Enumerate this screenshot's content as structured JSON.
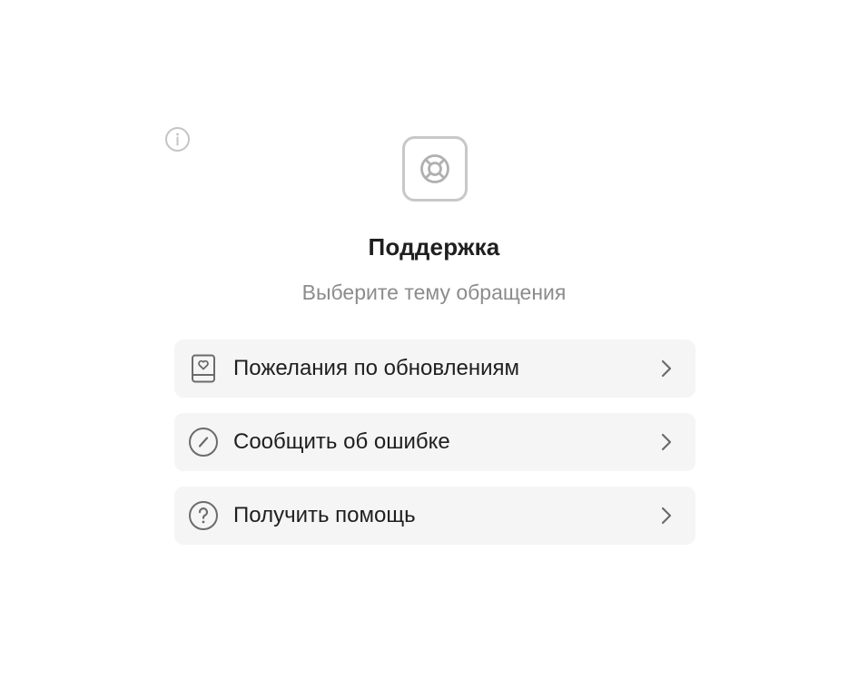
{
  "header": {
    "info_icon": "info-circle-icon",
    "hero_icon": "lifebuoy-icon",
    "title": "Поддержка",
    "subtitle": "Выберите тему обращения"
  },
  "menu": {
    "items": [
      {
        "label": "Пожелания по обновлениям",
        "icon": "book-heart-icon"
      },
      {
        "label": "Сообщить об ошибке",
        "icon": "slash-circle-icon"
      },
      {
        "label": "Получить помощь",
        "icon": "question-circle-icon"
      }
    ],
    "chevron_icon": "chevron-right-icon"
  },
  "colors": {
    "background": "#ffffff",
    "item_background": "#f5f5f5",
    "text_primary": "#1f1f1f",
    "text_secondary": "#8c8c8c",
    "icon_muted": "#c4c4c4",
    "icon_dark": "#6b6b6b"
  }
}
